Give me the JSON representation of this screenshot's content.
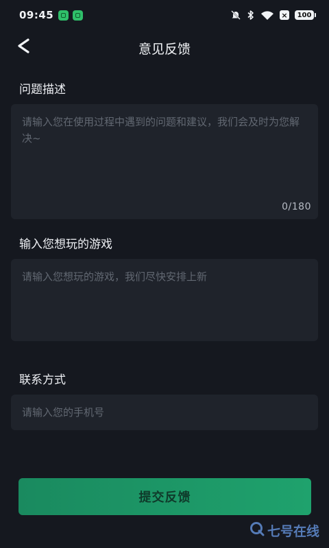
{
  "status_bar": {
    "time": "09:45",
    "battery": "100"
  },
  "nav": {
    "title": "意见反馈"
  },
  "problem": {
    "label": "问题描述",
    "placeholder": "请输入您在使用过程中遇到的问题和建议，我们会及时为您解决~",
    "counter": "0/180"
  },
  "game": {
    "label": "输入您想玩的游戏",
    "placeholder": "请输入您想玩的游戏，我们尽快安排上新"
  },
  "contact": {
    "label": "联系方式",
    "placeholder": "请输入您的手机号"
  },
  "submit": {
    "label": "提交反馈"
  },
  "watermark": {
    "text": "七号在线"
  },
  "colors": {
    "background": "#15181f",
    "field": "#1f232b",
    "accent": "#1fa26d"
  }
}
